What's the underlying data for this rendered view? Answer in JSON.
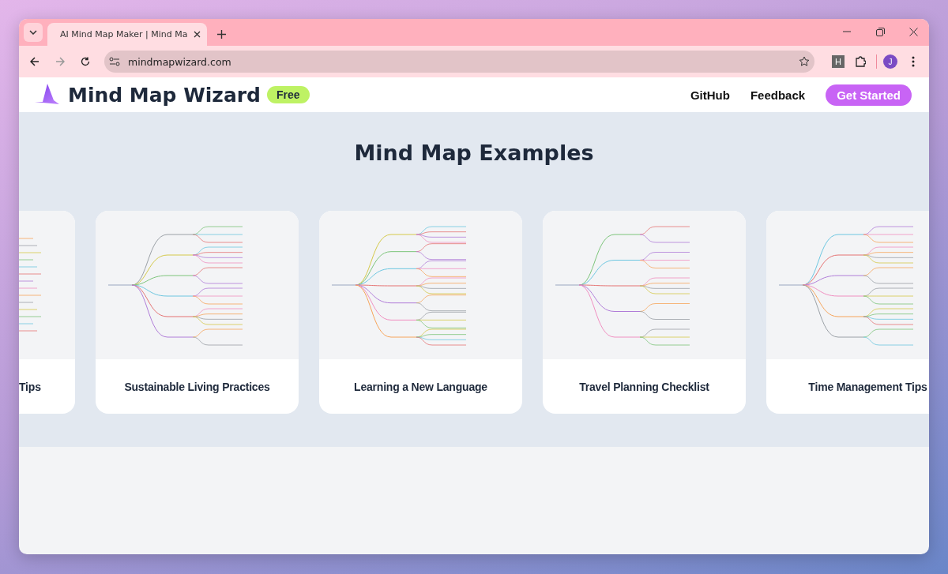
{
  "browser": {
    "tab_title": "AI Mind Map Maker | Mind Ma",
    "url": "mindmapwizard.com",
    "profile_initial": "J",
    "extension_letter": "H"
  },
  "header": {
    "brand": "Mind Map Wizard",
    "badge": "Free",
    "nav": [
      "GitHub",
      "Feedback"
    ],
    "cta": "Get Started"
  },
  "section": {
    "title": "Mind Map Examples",
    "cards": [
      {
        "title": "Tips",
        "kind": "partial"
      },
      {
        "title": "Sustainable Living Practices",
        "kind": "full"
      },
      {
        "title": "Learning a New Language",
        "kind": "full"
      },
      {
        "title": "Travel Planning Checklist",
        "kind": "full"
      },
      {
        "title": "Time Management Tips",
        "kind": "full"
      }
    ]
  }
}
